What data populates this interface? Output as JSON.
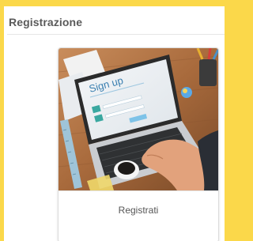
{
  "panel": {
    "title": "Registrazione"
  },
  "card": {
    "image_screen_text": "Sign up",
    "button_label": "Registrati"
  },
  "colors": {
    "page_background": "#fbd84a",
    "panel_background": "#ffffff",
    "title_text": "#5a5a5a",
    "card_label_text": "#555555"
  }
}
